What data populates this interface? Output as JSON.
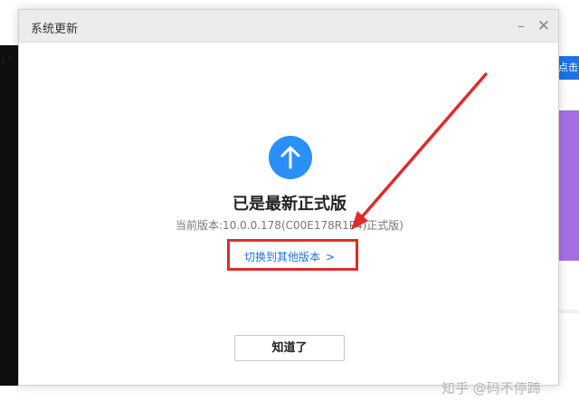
{
  "dialog": {
    "title": "系统更新",
    "minimize_label": "–",
    "close_label": "✕",
    "heading": "已是最新正式版",
    "current_version": "当前版本:10.0.0.178(C00E178R1P4)正式版)",
    "switch_version_label": "切换到其他版本",
    "switch_version_chevron": ">",
    "ok_button_label": "知道了"
  },
  "background": {
    "blue_button_text": "点击"
  },
  "watermark": "知乎 @码不停蹄",
  "colors": {
    "accent_blue": "#2a8ff7",
    "link_blue": "#1a73e8",
    "annotation_red": "#e02b2b",
    "titlebar_gray": "#ececec"
  },
  "icons": {
    "update_status": "arrow-up-circle-icon",
    "annotation": "red-arrow-annotation"
  }
}
